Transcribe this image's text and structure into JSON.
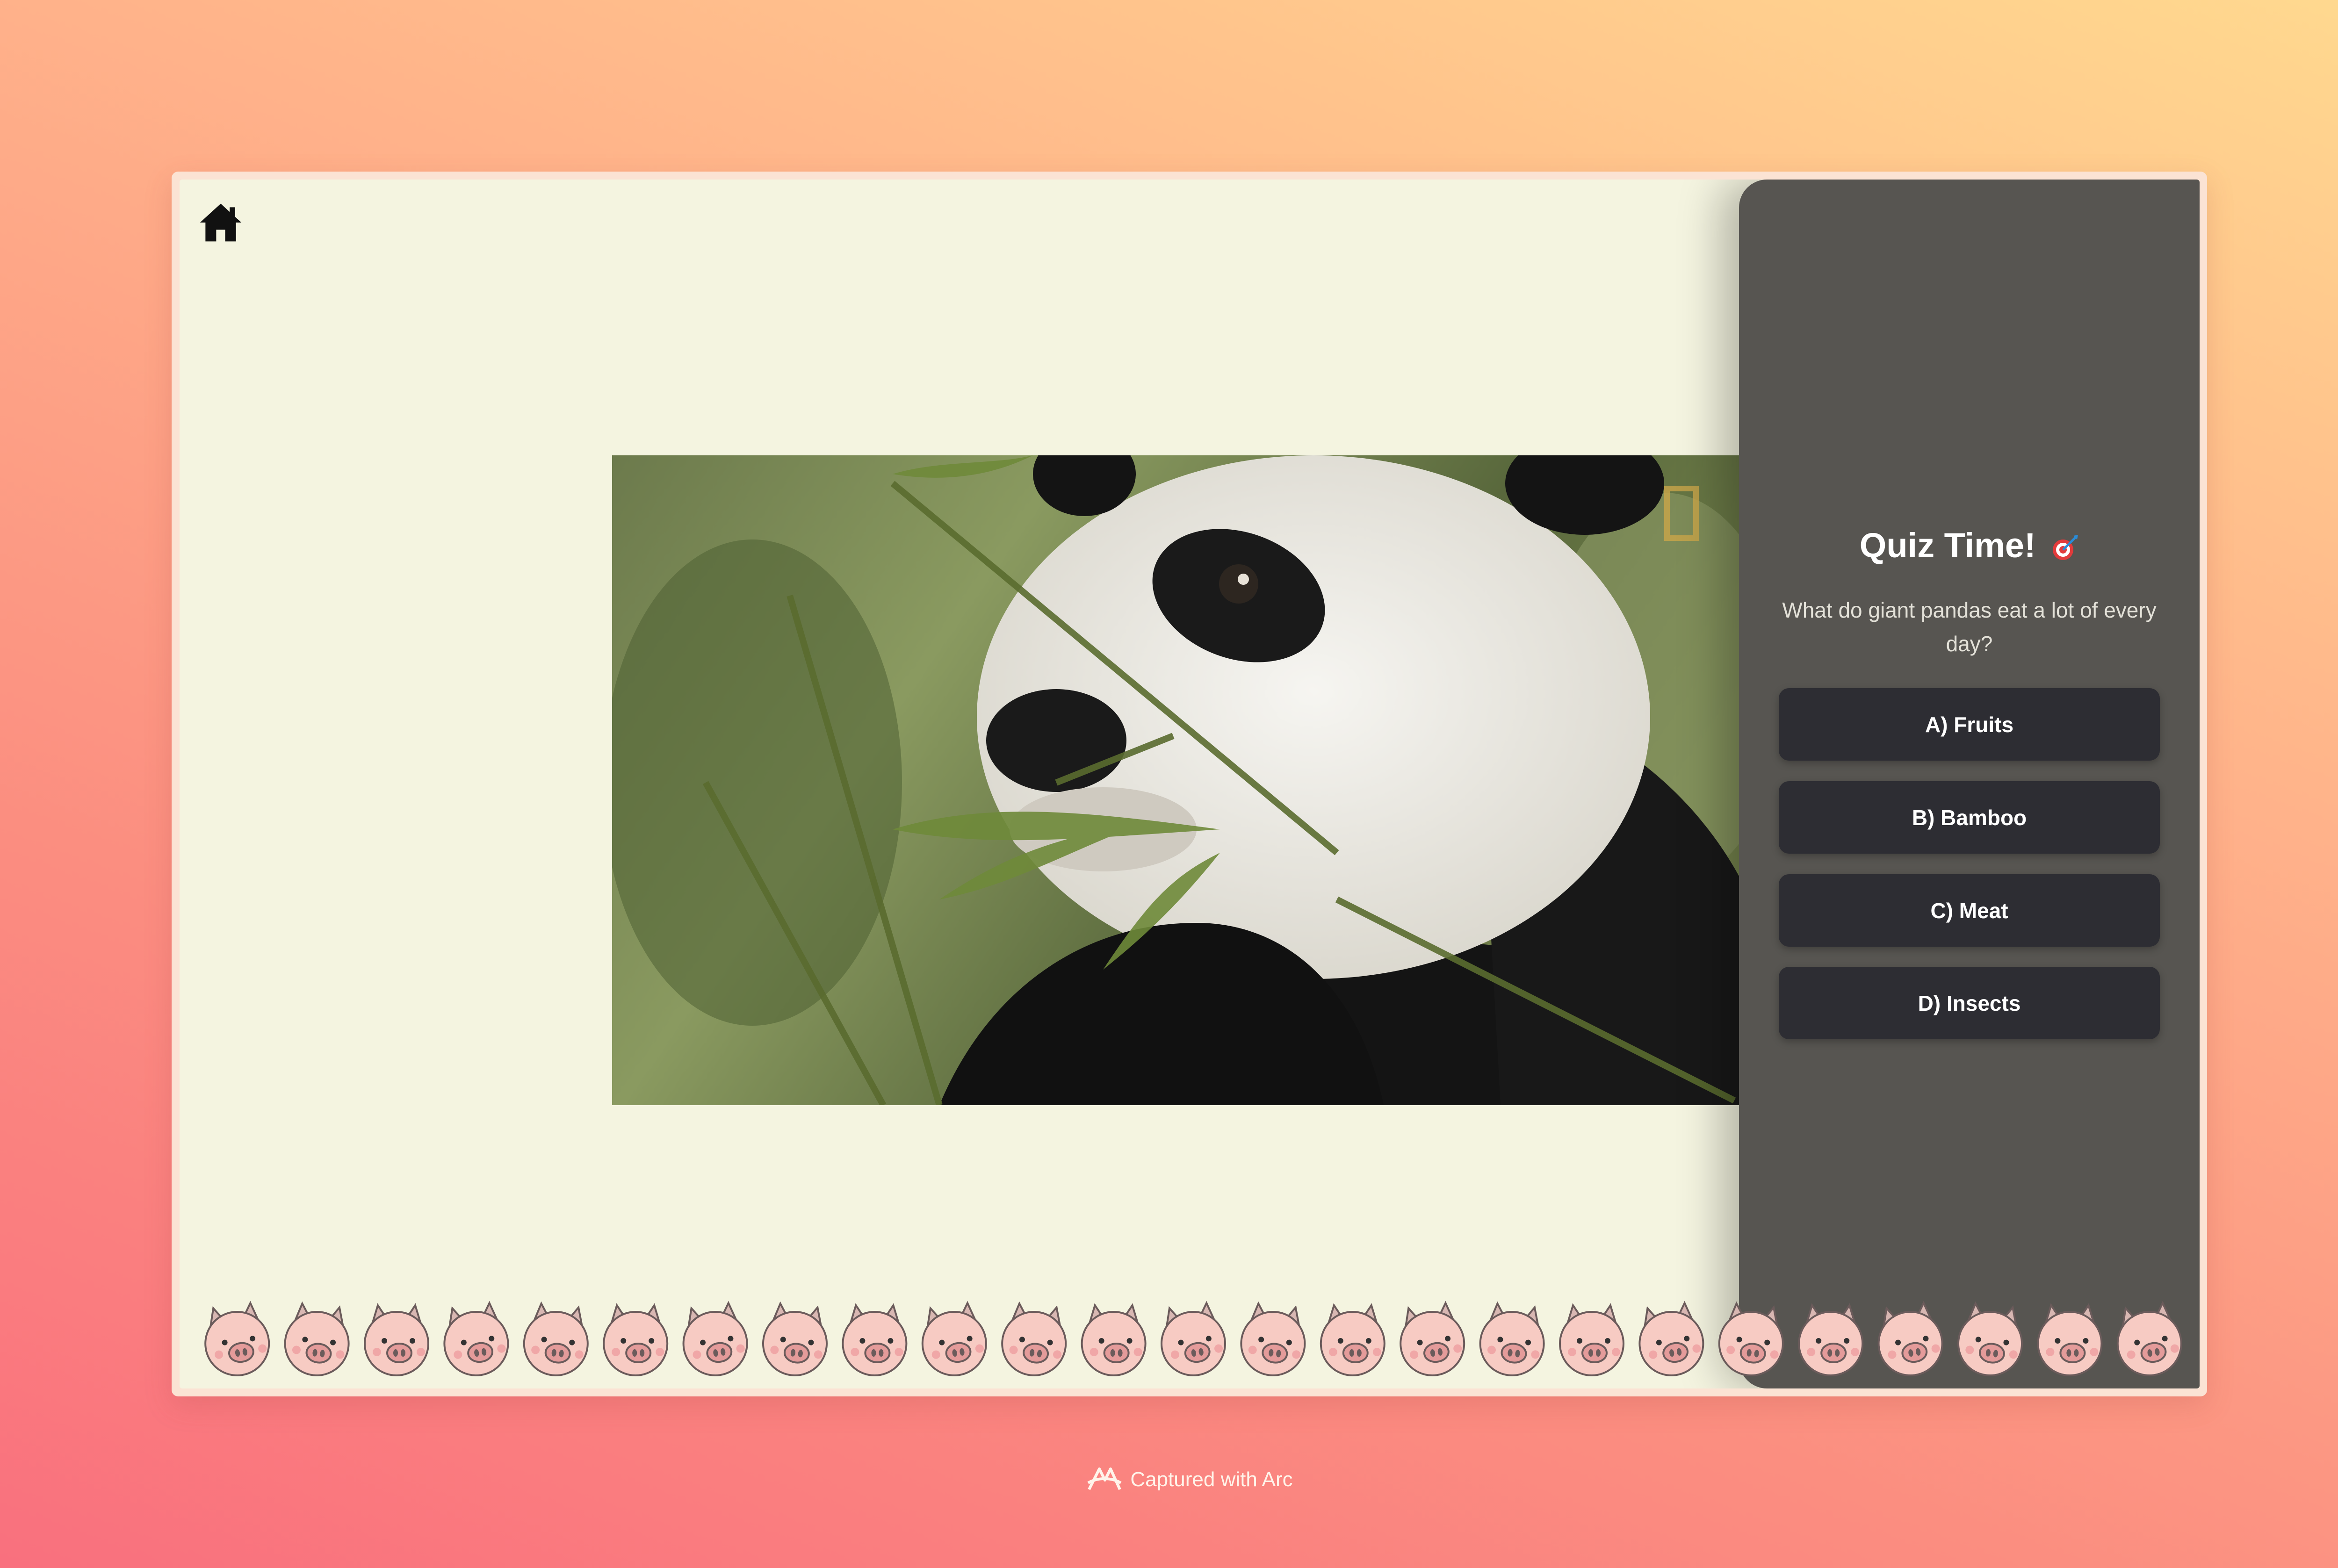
{
  "home": {
    "icon": "home-icon"
  },
  "video": {
    "subject": "panda",
    "logo_icon": "rectangle-logo-icon"
  },
  "quiz": {
    "title": "Quiz Time!",
    "title_icon": "target-icon",
    "question": "What do giant pandas eat a lot of every day?",
    "answers": [
      {
        "label": "A) Fruits"
      },
      {
        "label": "B) Bamboo"
      },
      {
        "label": "C) Meat"
      },
      {
        "label": "D) Insects"
      }
    ]
  },
  "decoration": {
    "border_icon": "pig-face-icon",
    "count": 25
  },
  "footer": {
    "text": "Captured with Arc",
    "icon": "arc-icon"
  },
  "colors": {
    "panel": "#575551",
    "answer_button": "#2d2d33",
    "canvas": "#f4f4e0"
  }
}
